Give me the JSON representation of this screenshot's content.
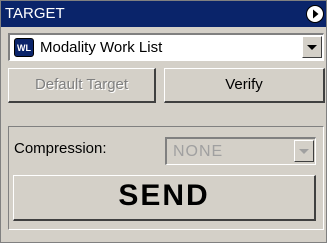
{
  "window": {
    "title": "TARGET"
  },
  "worklist": {
    "icon_text": "WL",
    "selected": "Modality Work List"
  },
  "buttons": {
    "default_target": "Default Target",
    "verify": "Verify",
    "send": "SEND"
  },
  "compression": {
    "label": "Compression:",
    "value": "NONE"
  },
  "colors": {
    "title_bar": "#0a246a",
    "face": "#d4d0c8"
  }
}
